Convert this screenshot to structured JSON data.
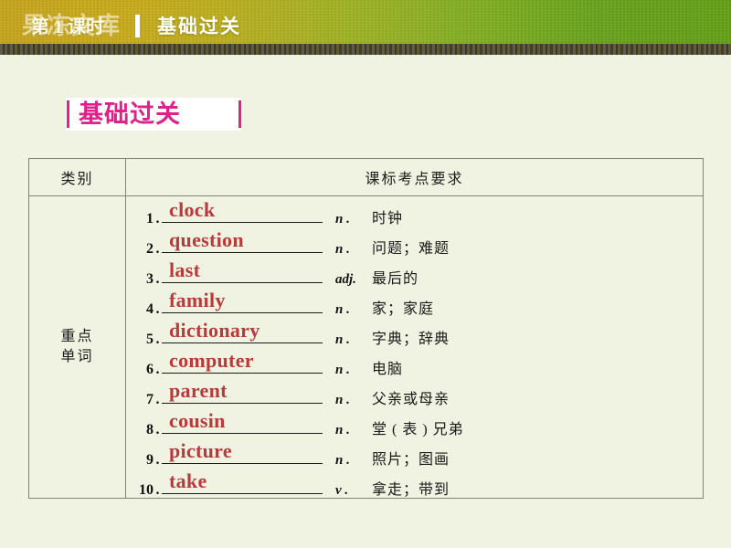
{
  "banner": {
    "watermark": "果冻文库",
    "lesson": "第 1 课时",
    "separator": "|",
    "title": "基础过关",
    "gradient_start": "#c6a41c",
    "gradient_end": "#63a015"
  },
  "section": {
    "title": "基础过关",
    "accent_color": "#e0218a"
  },
  "table": {
    "headers": [
      "类别",
      "课标考点要求"
    ],
    "category_label": "重点\n单词",
    "category_label_lines": [
      "重点",
      "单词"
    ],
    "rows": [
      {
        "num": "1",
        "dot": ".",
        "word": "clock",
        "pos": "n .",
        "meaning": "时钟"
      },
      {
        "num": "2",
        "dot": ".",
        "word": "question",
        "pos": "n .",
        "meaning": "问题；难题"
      },
      {
        "num": "3",
        "dot": ".",
        "word": "last",
        "pos": "adj.",
        "meaning": "最后的"
      },
      {
        "num": "4",
        "dot": ".",
        "word": "family",
        "pos": "n .",
        "meaning": "家；家庭"
      },
      {
        "num": "5",
        "dot": ".",
        "word": "dictionary",
        "pos": "n .",
        "meaning": "字典；辞典"
      },
      {
        "num": "6",
        "dot": ".",
        "word": "computer",
        "pos": "n .",
        "meaning": "电脑"
      },
      {
        "num": "7",
        "dot": ".",
        "word": "parent",
        "pos": "n .",
        "meaning": "父亲或母亲"
      },
      {
        "num": "8",
        "dot": ".",
        "word": "cousin",
        "pos": "n .",
        "meaning": "堂 ( 表 ) 兄弟"
      },
      {
        "num": "9",
        "dot": ".",
        "word": "picture",
        "pos": "n .",
        "meaning": "照片；图画"
      },
      {
        "num": "10",
        "dot": ".",
        "word": "take",
        "pos": "v .",
        "meaning": "拿走；带到"
      }
    ]
  },
  "colors": {
    "page_background": "#f0f2e2",
    "answer_text": "#b93a3a",
    "table_border": "#7d8472"
  }
}
